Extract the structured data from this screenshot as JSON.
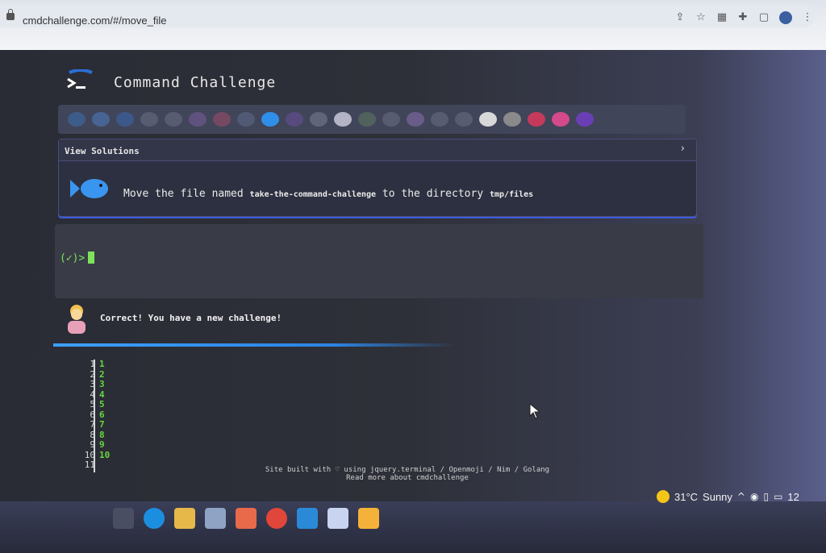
{
  "browser": {
    "url": "cmdchallenge.com/#/move_file"
  },
  "header": {
    "title": "Command Challenge"
  },
  "solutions": {
    "title": "View Solutions",
    "chevron": "›"
  },
  "challenge": {
    "prefix": "Move the file named ",
    "file": "take-the-command-challenge",
    "middle": " to the directory ",
    "dir": "tmp/files"
  },
  "terminal": {
    "prompt": "(✓)>"
  },
  "status": {
    "message": "Correct! You have a new challenge!"
  },
  "output": {
    "line_numbers": [
      "1",
      "2",
      "3",
      "4",
      "5",
      "6",
      "7",
      "8",
      "9",
      "10",
      "11"
    ],
    "values": [
      "1",
      "2",
      "3",
      "4",
      "5",
      "6",
      "7",
      "8",
      "9",
      "10"
    ]
  },
  "footer": {
    "line1": "Site built with ♡ using jquery.terminal / Openmoji / Nim / Golang",
    "line2": "Read more about cmdchallenge"
  },
  "taskbar": {
    "temperature": "31°C",
    "condition": "Sunny",
    "clock": "12"
  },
  "colors": {
    "accent": "#3e5ad9",
    "prompt_green": "#7de35a",
    "output_green": "#66d63e"
  }
}
